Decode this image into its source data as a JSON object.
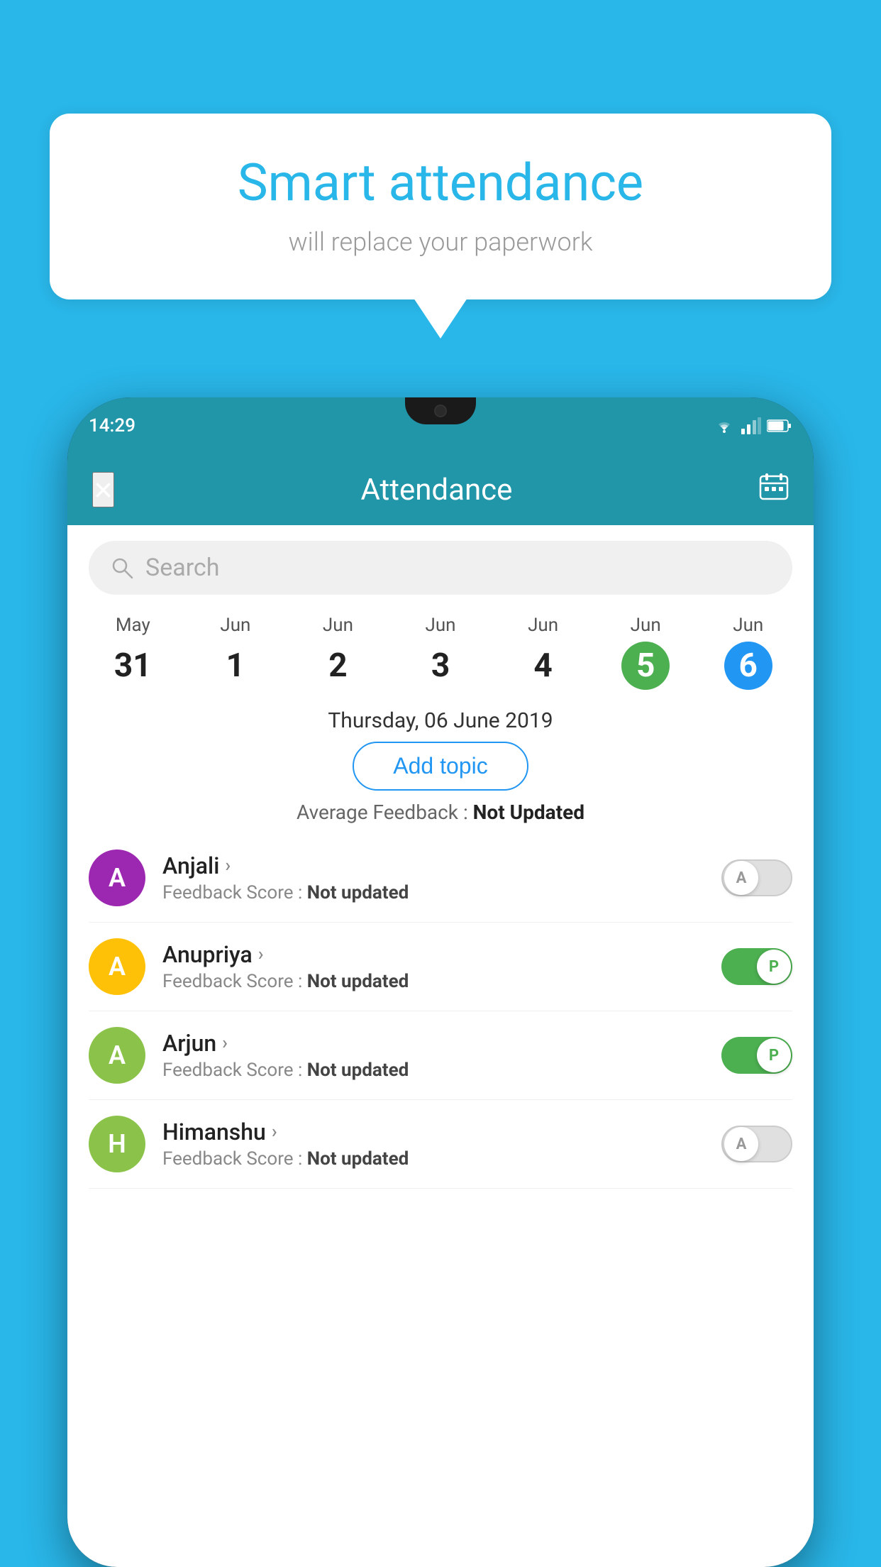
{
  "background_color": "#29B6E8",
  "bubble": {
    "title": "Smart attendance",
    "subtitle": "will replace your paperwork"
  },
  "status_bar": {
    "time": "14:29",
    "icons": [
      "wifi",
      "signal",
      "battery"
    ]
  },
  "header": {
    "title": "Attendance",
    "close_label": "×",
    "calendar_icon": "📅"
  },
  "search": {
    "placeholder": "Search"
  },
  "calendar": {
    "dates": [
      {
        "month": "May",
        "day": "31",
        "style": "normal"
      },
      {
        "month": "Jun",
        "day": "1",
        "style": "normal"
      },
      {
        "month": "Jun",
        "day": "2",
        "style": "normal"
      },
      {
        "month": "Jun",
        "day": "3",
        "style": "normal"
      },
      {
        "month": "Jun",
        "day": "4",
        "style": "normal"
      },
      {
        "month": "Jun",
        "day": "5",
        "style": "today"
      },
      {
        "month": "Jun",
        "day": "6",
        "style": "selected"
      }
    ]
  },
  "selected_date": "Thursday, 06 June 2019",
  "add_topic_label": "Add topic",
  "avg_feedback_label": "Average Feedback : ",
  "avg_feedback_value": "Not Updated",
  "students": [
    {
      "name": "Anjali",
      "avatar_letter": "A",
      "avatar_color": "#9C27B0",
      "feedback_label": "Feedback Score : ",
      "feedback_value": "Not updated",
      "toggle_on": false,
      "toggle_letter": "A"
    },
    {
      "name": "Anupriya",
      "avatar_letter": "A",
      "avatar_color": "#FFC107",
      "feedback_label": "Feedback Score : ",
      "feedback_value": "Not updated",
      "toggle_on": true,
      "toggle_letter": "P"
    },
    {
      "name": "Arjun",
      "avatar_letter": "A",
      "avatar_color": "#8BC34A",
      "feedback_label": "Feedback Score : ",
      "feedback_value": "Not updated",
      "toggle_on": true,
      "toggle_letter": "P"
    },
    {
      "name": "Himanshu",
      "avatar_letter": "H",
      "avatar_color": "#8BC34A",
      "feedback_label": "Feedback Score : ",
      "feedback_value": "Not updated",
      "toggle_on": false,
      "toggle_letter": "A"
    }
  ]
}
